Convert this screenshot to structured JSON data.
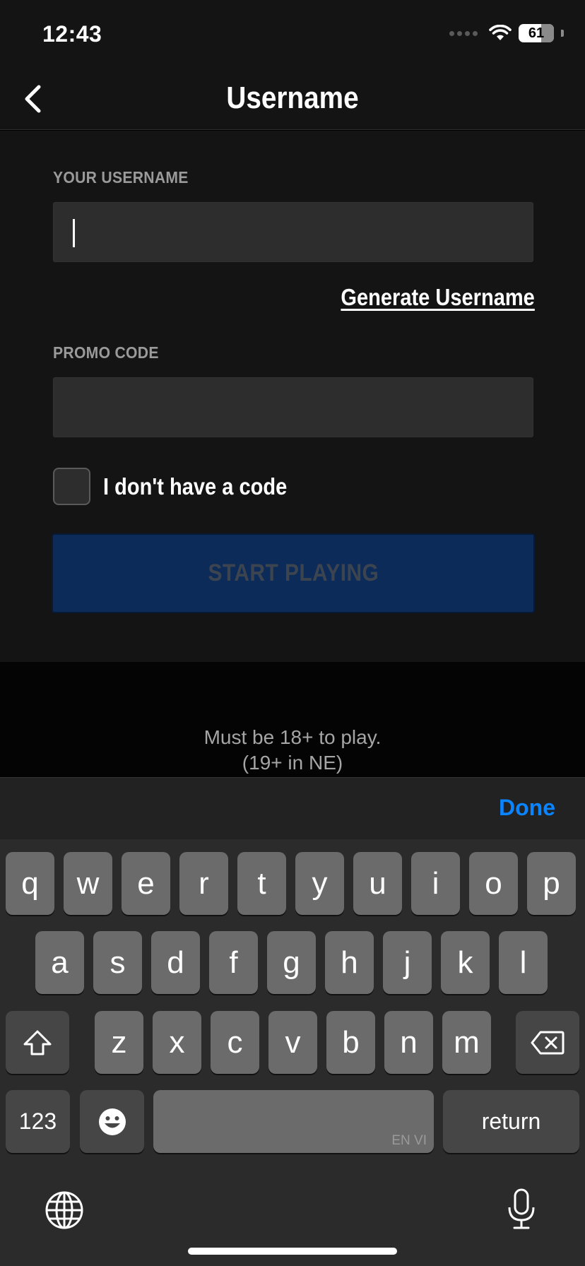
{
  "status_bar": {
    "time": "12:43",
    "battery": "61"
  },
  "nav": {
    "title": "Username"
  },
  "form": {
    "username_label": "YOUR USERNAME",
    "username_value": "",
    "generate_link": "Generate Username",
    "promo_label": "PROMO CODE",
    "promo_value": "",
    "no_code_label": "I don't have a code",
    "start_button": "START PLAYING"
  },
  "age_notice": {
    "line1": "Must be 18+ to play.",
    "line2": "(19+ in NE)"
  },
  "keyboard": {
    "done": "Done",
    "row1": [
      "q",
      "w",
      "e",
      "r",
      "t",
      "y",
      "u",
      "i",
      "o",
      "p"
    ],
    "row2": [
      "a",
      "s",
      "d",
      "f",
      "g",
      "h",
      "j",
      "k",
      "l"
    ],
    "row3": [
      "z",
      "x",
      "c",
      "v",
      "b",
      "n",
      "m"
    ],
    "numbers_key": "123",
    "return_key": "return",
    "space_lang": "EN VI",
    "icons": [
      "shift-icon",
      "delete-icon",
      "emoji-icon",
      "globe-icon",
      "microphone-icon"
    ]
  },
  "colors": {
    "accent": "#0a84ff",
    "button_bg": "#0c2b58",
    "background": "#141414"
  }
}
